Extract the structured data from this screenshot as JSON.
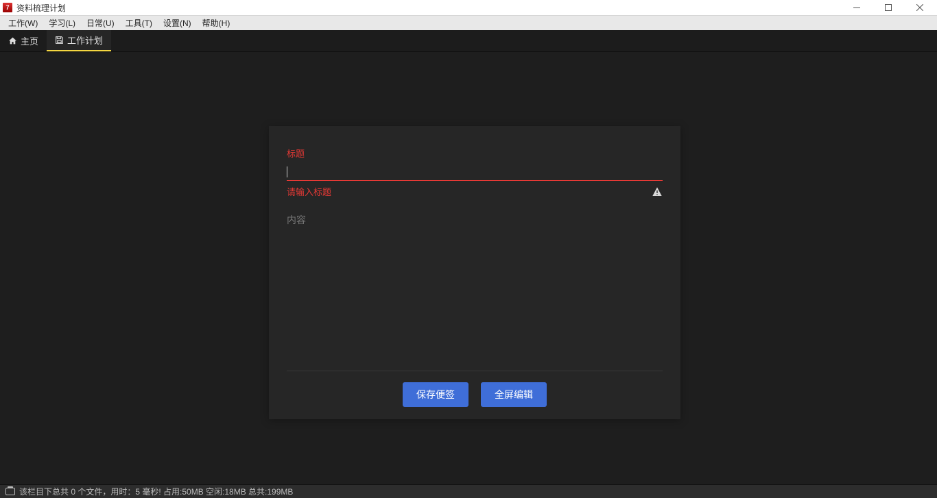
{
  "window": {
    "title": "资料梳理计划"
  },
  "menu": {
    "work": "工作(W)",
    "study": "学习(L)",
    "daily": "日常(U)",
    "tool": "工具(T)",
    "settings": "设置(N)",
    "help": "帮助(H)"
  },
  "tabs": {
    "home": "主页",
    "workplan": "工作计划"
  },
  "form": {
    "title_label": "标题",
    "title_value": "",
    "title_error": "请输入标题",
    "content_label": "内容",
    "content_value": "",
    "save_btn": "保存便签",
    "fullscreen_btn": "全屏编辑"
  },
  "status": {
    "text": "该栏目下总共 0 个文件，用时：5 毫秒! 占用:50MB 空闲:18MB 总共:199MB"
  }
}
